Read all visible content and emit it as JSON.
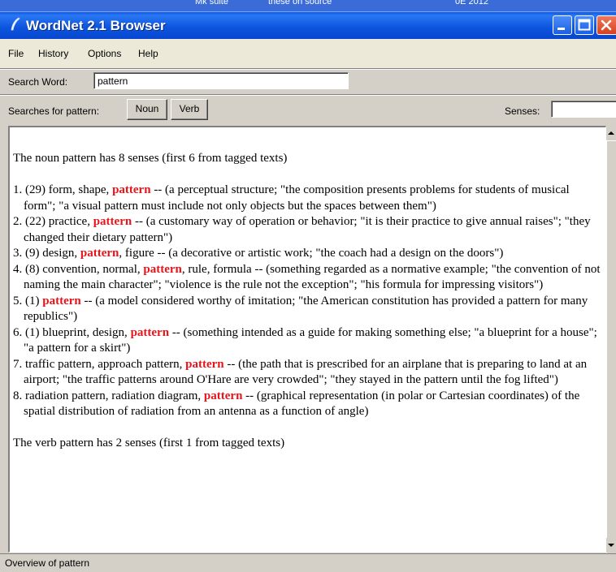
{
  "background_strip": {
    "texts": [
      "Mk suite",
      "these on source",
      "0E 2012"
    ]
  },
  "window": {
    "title": "WordNet 2.1 Browser"
  },
  "menu": {
    "items": [
      "File",
      "History",
      "Options",
      "Help"
    ]
  },
  "search": {
    "label": "Search Word:",
    "value": "pattern"
  },
  "searches_bar": {
    "label": "Searches for pattern:",
    "noun_button": "Noun",
    "verb_button": "Verb",
    "senses_label": "Senses:",
    "senses_value": ""
  },
  "results": {
    "noun_header": "The noun pattern has 8 senses (first 6 from tagged texts)",
    "senses": [
      {
        "prefix": "1. (29) form, shape, ",
        "keyword": "pattern",
        "suffix": " -- (a perceptual structure; \"the composition presents problems for students of musical form\"; \"a visual pattern must include not only objects but the spaces between them\")"
      },
      {
        "prefix": "2. (22) practice, ",
        "keyword": "pattern",
        "suffix": " -- (a customary way of operation or behavior; \"it is their practice to give annual raises\"; \"they changed their dietary pattern\")"
      },
      {
        "prefix": "3. (9) design, ",
        "keyword": "pattern",
        "suffix": ", figure -- (a decorative or artistic work; \"the coach had a design on the doors\")"
      },
      {
        "prefix": "4. (8) convention, normal, ",
        "keyword": "pattern",
        "suffix": ", rule, formula -- (something regarded as a normative example; \"the convention of not naming the main character\"; \"violence is the rule not the exception\"; \"his formula for impressing visitors\")"
      },
      {
        "prefix": "5. (1) ",
        "keyword": "pattern",
        "suffix": " -- (a model considered worthy of imitation; \"the American constitution has provided a pattern for many republics\")"
      },
      {
        "prefix": "6. (1) blueprint, design, ",
        "keyword": "pattern",
        "suffix": " -- (something intended as a guide for making something else; \"a blueprint for a house\"; \"a pattern for a skirt\")"
      },
      {
        "prefix": "7. traffic pattern, approach pattern, ",
        "keyword": "pattern",
        "suffix": " -- (the path that is prescribed for an airplane that is preparing to land at an airport; \"the traffic patterns around O'Hare are very crowded\"; \"they stayed in the pattern until the fog lifted\")"
      },
      {
        "prefix": "8. radiation pattern, radiation diagram, ",
        "keyword": "pattern",
        "suffix": " -- (graphical representation (in polar or Cartesian coordinates) of the spatial distribution of radiation from an antenna as a function of angle)"
      }
    ],
    "verb_header": "The verb pattern has 2 senses (first 1 from tagged texts)"
  },
  "status": {
    "text": "Overview of pattern"
  },
  "colors": {
    "highlight": "#e8141a",
    "titlebar": "#0a58e8",
    "chrome": "#d4d0c8"
  },
  "icons": {
    "title": "feather-icon",
    "minimize": "minimize-icon",
    "maximize": "maximize-icon",
    "close": "close-icon"
  }
}
